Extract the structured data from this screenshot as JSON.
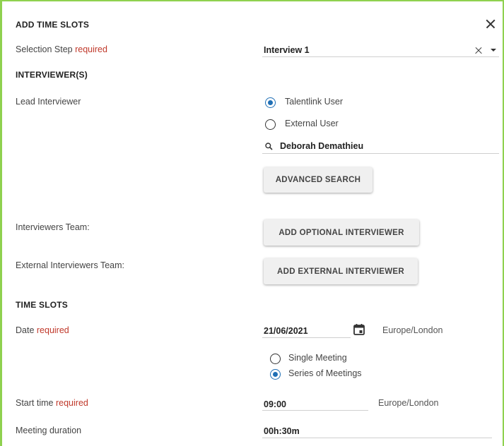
{
  "header": {
    "title": "ADD TIME SLOTS"
  },
  "selection_step": {
    "label": "Selection Step",
    "required": "required",
    "value": "Interview 1"
  },
  "interviewers": {
    "section_title": "INTERVIEWER(S)",
    "lead_label": "Lead Interviewer",
    "options": [
      "Talentlink User",
      "External User"
    ],
    "selected_option": "Talentlink User",
    "search_value": "Deborah Demathieu",
    "advanced_search_label": "ADVANCED SEARCH",
    "team_label": "Interviewers Team:",
    "add_optional_label": "ADD OPTIONAL INTERVIEWER",
    "external_team_label": "External Interviewers Team:",
    "add_external_label": "ADD EXTERNAL INTERVIEWER"
  },
  "time_slots": {
    "section_title": "TIME SLOTS",
    "date_label": "Date",
    "date_required": "required",
    "date_value": "21/06/2021",
    "date_timezone": "Europe/London",
    "meeting_options": [
      "Single Meeting",
      "Series of Meetings"
    ],
    "selected_meeting": "Series of Meetings",
    "start_label": "Start time",
    "start_required": "required",
    "start_value": "09:00",
    "start_timezone": "Europe/London",
    "duration_label": "Meeting duration",
    "duration_value": "00h:30m"
  },
  "colors": {
    "accent": "#1f6fb5",
    "required": "#c0392b",
    "frame": "#8fd14f"
  },
  "icons": [
    "close-icon",
    "clear-icon",
    "dropdown-caret-icon",
    "search-icon",
    "calendar-icon"
  ]
}
